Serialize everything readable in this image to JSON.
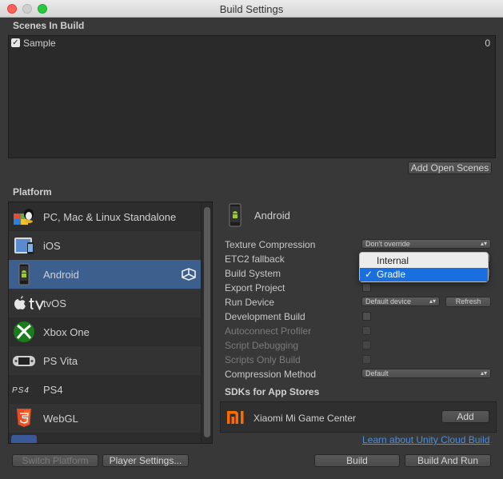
{
  "window": {
    "title": "Build Settings"
  },
  "scenes": {
    "header": "Scenes In Build",
    "items": [
      {
        "checked": true,
        "name": "Sample",
        "index": "0"
      }
    ],
    "add_open_label": "Add Open Scenes"
  },
  "platform": {
    "header": "Platform",
    "items": [
      {
        "label": "PC, Mac & Linux Standalone",
        "icon": "pc-mac-linux-icon"
      },
      {
        "label": "iOS",
        "icon": "ios-icon"
      },
      {
        "label": "Android",
        "icon": "android-icon",
        "selected": true
      },
      {
        "label": "tvOS",
        "icon": "appletv-icon"
      },
      {
        "label": "Xbox One",
        "icon": "xbox-icon"
      },
      {
        "label": "PS Vita",
        "icon": "psvita-icon"
      },
      {
        "label": "PS4",
        "icon": "ps4-icon"
      },
      {
        "label": "WebGL",
        "icon": "html5-icon"
      }
    ]
  },
  "settings": {
    "platform_title": "Android",
    "texture_compression": {
      "label": "Texture Compression",
      "value": "Don't override"
    },
    "etc2_fallback": {
      "label": "ETC2 fallback"
    },
    "build_system": {
      "label": "Build System",
      "options": [
        "Internal",
        "Gradle"
      ],
      "selected": "Gradle"
    },
    "export_project": {
      "label": "Export Project"
    },
    "run_device": {
      "label": "Run Device",
      "value": "Default device",
      "refresh_label": "Refresh"
    },
    "development_build": {
      "label": "Development Build"
    },
    "autoconnect_profiler": {
      "label": "Autoconnect Profiler"
    },
    "script_debugging": {
      "label": "Script Debugging"
    },
    "scripts_only_build": {
      "label": "Scripts Only Build"
    },
    "compression_method": {
      "label": "Compression Method",
      "value": "Default"
    },
    "sdk_header": "SDKs for App Stores",
    "sdk": {
      "name": "Xiaomi Mi Game Center",
      "add_label": "Add"
    },
    "cloud_link": "Learn about Unity Cloud Build"
  },
  "footer": {
    "switch_platform": "Switch Platform",
    "player_settings": "Player Settings...",
    "build": "Build",
    "build_and_run": "Build And Run"
  },
  "colors": {
    "background": "#383838",
    "selected_row": "#3d5f8e",
    "link": "#4c8fde",
    "menu_highlight": "#1a6fde"
  }
}
